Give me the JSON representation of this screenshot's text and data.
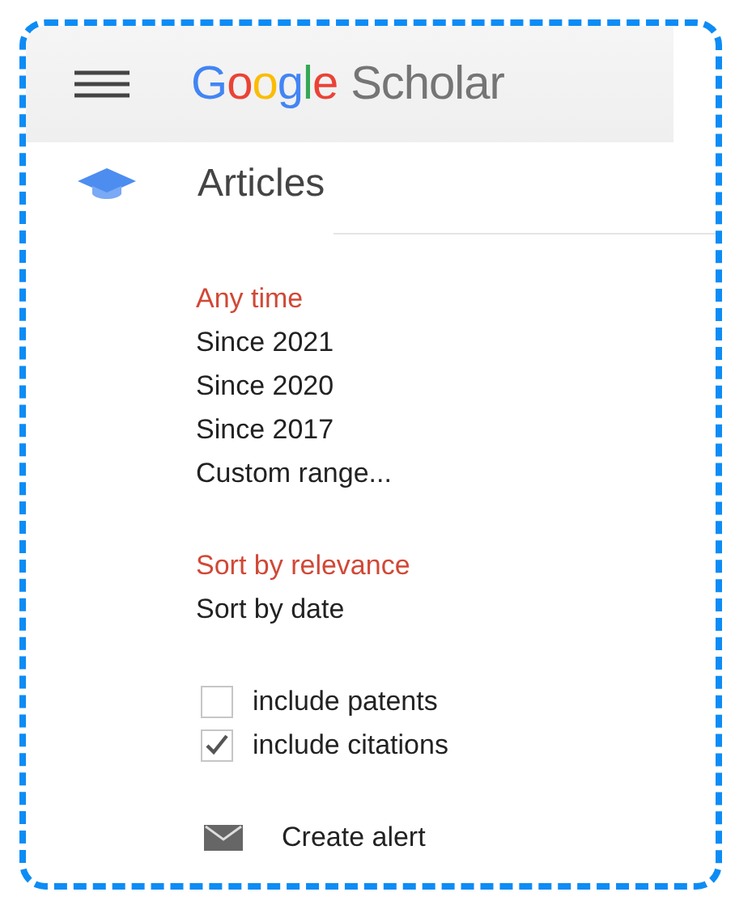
{
  "header": {
    "logo_brand": "Google",
    "logo_product": "Scholar"
  },
  "nav": {
    "label": "Articles"
  },
  "time_filters": [
    {
      "label": "Any time",
      "selected": true
    },
    {
      "label": "Since 2021",
      "selected": false
    },
    {
      "label": "Since 2020",
      "selected": false
    },
    {
      "label": "Since 2017",
      "selected": false
    },
    {
      "label": "Custom range...",
      "selected": false
    }
  ],
  "sort_options": [
    {
      "label": "Sort by relevance",
      "selected": true
    },
    {
      "label": "Sort by date",
      "selected": false
    }
  ],
  "checkboxes": [
    {
      "label": "include patents",
      "checked": false
    },
    {
      "label": "include citations",
      "checked": true
    }
  ],
  "alert": {
    "label": "Create alert"
  }
}
